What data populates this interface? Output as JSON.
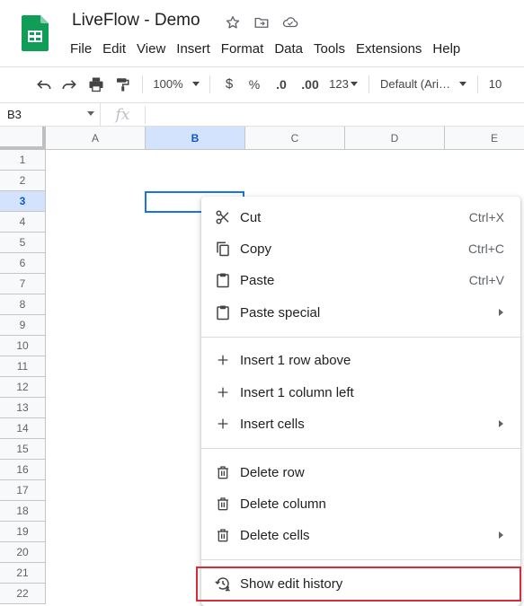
{
  "header": {
    "title": "LiveFlow - Demo",
    "menu": [
      "File",
      "Edit",
      "View",
      "Insert",
      "Format",
      "Data",
      "Tools",
      "Extensions",
      "Help"
    ]
  },
  "toolbar": {
    "zoom": "100%",
    "currency": "$",
    "percent": "%",
    "decrease_decimal": ".0",
    "increase_decimal": ".00",
    "more_formats": "123",
    "font": "Default (Ari…",
    "font_size": "10"
  },
  "formula_bar": {
    "name_box": "B3",
    "fx": "fx"
  },
  "grid": {
    "columns": [
      "A",
      "B",
      "C",
      "D",
      "E"
    ],
    "rows": [
      "1",
      "2",
      "3",
      "4",
      "5",
      "6",
      "7",
      "8",
      "9",
      "10",
      "11",
      "12",
      "13",
      "14",
      "15",
      "16",
      "17",
      "18",
      "19",
      "20",
      "21",
      "22"
    ],
    "selected_column": "B",
    "selected_row": "3"
  },
  "context_menu": {
    "items": [
      {
        "label": "Cut",
        "shortcut": "Ctrl+X",
        "icon": "scissors-icon"
      },
      {
        "label": "Copy",
        "shortcut": "Ctrl+C",
        "icon": "copy-icon"
      },
      {
        "label": "Paste",
        "shortcut": "Ctrl+V",
        "icon": "clipboard-icon"
      },
      {
        "label": "Paste special",
        "submenu": true,
        "icon": "clipboard-icon"
      },
      {
        "label": "Insert 1 row above",
        "icon": "plus-icon"
      },
      {
        "label": "Insert 1 column left",
        "icon": "plus-icon"
      },
      {
        "label": "Insert cells",
        "submenu": true,
        "icon": "plus-icon"
      },
      {
        "label": "Delete row",
        "icon": "trash-icon"
      },
      {
        "label": "Delete column",
        "icon": "trash-icon"
      },
      {
        "label": "Delete cells",
        "submenu": true,
        "icon": "trash-icon"
      },
      {
        "label": "Show edit history",
        "icon": "history-icon",
        "highlighted": true
      }
    ]
  },
  "colors": {
    "sheets_green": "#0f9d58",
    "selection_blue": "#1a73e8",
    "highlight_red": "#d32f3a"
  }
}
